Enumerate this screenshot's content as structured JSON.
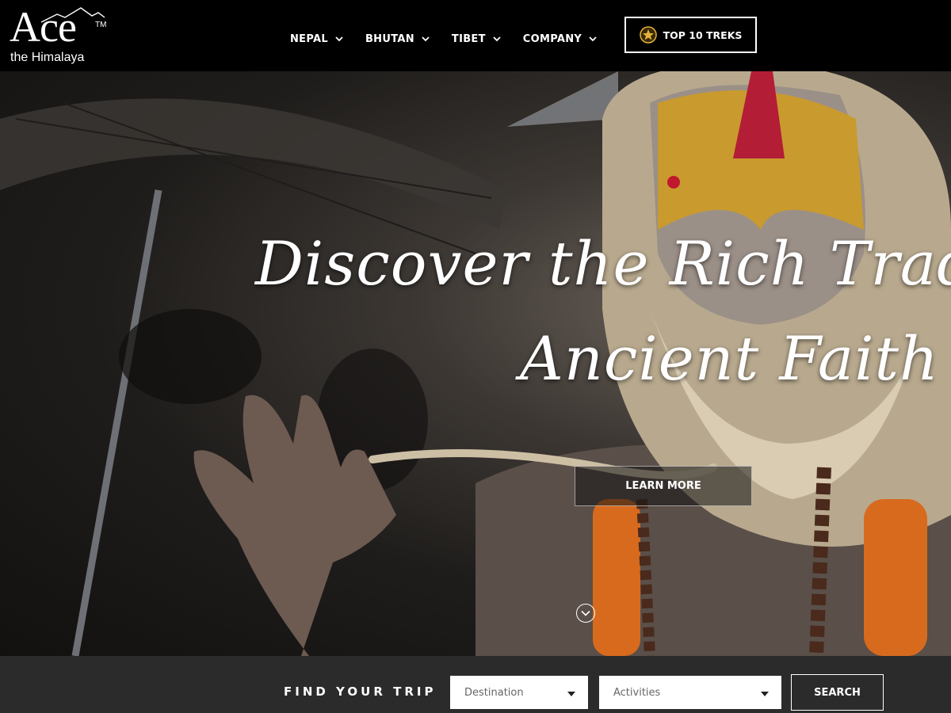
{
  "brand": {
    "logo_main": "Ace",
    "logo_tm": "TM",
    "logo_sub": "the Himalaya"
  },
  "nav": {
    "items": [
      {
        "label": "NEPAL"
      },
      {
        "label": "BHUTAN"
      },
      {
        "label": "TIBET"
      },
      {
        "label": "COMPANY"
      }
    ],
    "cta_label": "TOP 10 TREKS"
  },
  "hero": {
    "headline_line1": "Discover the Rich Traditions of N",
    "headline_line2": "Ancient Faith",
    "button_label": "LEARN MORE"
  },
  "search": {
    "title": "FIND YOUR TRIP",
    "destination_placeholder": "Destination",
    "activities_placeholder": "Activities",
    "button_label": "SEARCH"
  },
  "colors": {
    "header_bg": "#000000",
    "search_bar_bg": "#2b2b2b",
    "text": "#ffffff",
    "badge_gold": "#e5b23a"
  }
}
